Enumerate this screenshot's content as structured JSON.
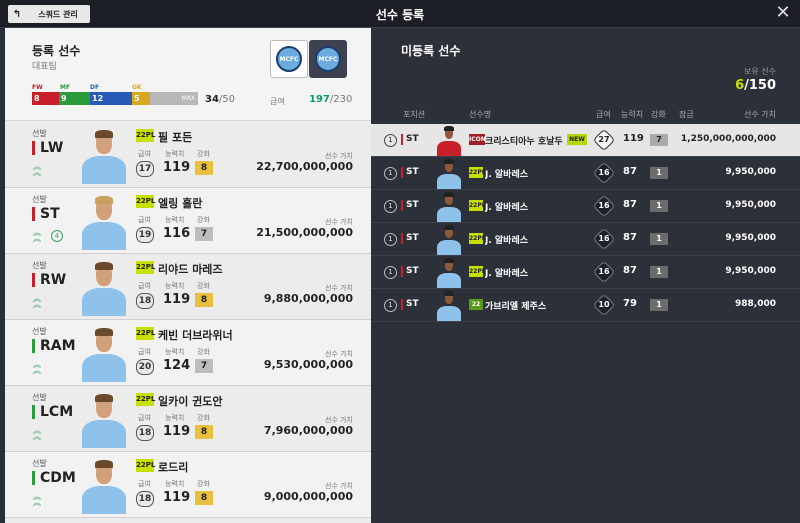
{
  "topbar": {
    "squad_button": "스쿼드 관리",
    "title": "선수 등록",
    "close": "✕"
  },
  "left": {
    "title": "등록 선수",
    "subtitle": "대표팀",
    "pos_counts": [
      {
        "label": "FW",
        "count": "8",
        "color": "#c8202a"
      },
      {
        "label": "MF",
        "count": "9",
        "color": "#2a9a3a"
      },
      {
        "label": "DF",
        "count": "12",
        "color": "#2a5ab8"
      },
      {
        "label": "GK",
        "count": "5",
        "color": "#d8a820"
      }
    ],
    "max_label": "MAX",
    "count": "34",
    "count_max": "/50",
    "salary_label": "급여",
    "salary": "197",
    "salary_max": "/230",
    "players": [
      {
        "label": "선발",
        "pos": "LW",
        "season": "22PL",
        "name": "필 포든",
        "pay": "17",
        "ovr": "119",
        "upg": "8",
        "upg_color": "gold",
        "value": "22,700,000,000",
        "pos_color": "red",
        "extra": ""
      },
      {
        "label": "선발",
        "pos": "ST",
        "season": "22PL",
        "name": "엘링 홀란",
        "pay": "19",
        "ovr": "116",
        "upg": "7",
        "upg_color": "gray",
        "value": "21,500,000,000",
        "pos_color": "red",
        "extra": "4"
      },
      {
        "label": "선발",
        "pos": "RW",
        "season": "22PL",
        "name": "리야드 마레즈",
        "pay": "18",
        "ovr": "119",
        "upg": "8",
        "upg_color": "gold",
        "value": "9,880,000,000",
        "pos_color": "red",
        "extra": ""
      },
      {
        "label": "선발",
        "pos": "RAM",
        "season": "22PL",
        "name": "케빈 더브라위너",
        "pay": "20",
        "ovr": "124",
        "upg": "7",
        "upg_color": "gray",
        "value": "9,530,000,000",
        "pos_color": "mid",
        "extra": ""
      },
      {
        "label": "선발",
        "pos": "LCM",
        "season": "22PL",
        "name": "일카이 귄도안",
        "pay": "18",
        "ovr": "119",
        "upg": "8",
        "upg_color": "gold",
        "value": "7,960,000,000",
        "pos_color": "mid",
        "extra": ""
      },
      {
        "label": "선발",
        "pos": "CDM",
        "season": "22PL",
        "name": "로드리",
        "pay": "18",
        "ovr": "119",
        "upg": "8",
        "upg_color": "gold",
        "value": "9,000,000,000",
        "pos_color": "mid",
        "extra": ""
      }
    ],
    "mini_labels": {
      "pay": "급여",
      "ovr": "능력치",
      "upg": "강화",
      "value": "선수 가치"
    }
  },
  "right": {
    "title": "미등록 선수",
    "own_label": "보유 선수",
    "own_count": "6",
    "own_max": "/150",
    "headers": {
      "pos": "포지션",
      "name": "선수명",
      "pay": "급여",
      "ovr": "능력치",
      "upg": "강화",
      "lock": "잠금",
      "value": "선수 가치"
    },
    "players": [
      {
        "rank": "1",
        "pos": "ST",
        "season": "ICON",
        "season_style": "red",
        "name": "크리스티아누 호날두",
        "new": "NEW",
        "pay": "27",
        "ovr": "119",
        "upg": "7",
        "value": "1,250,000,000,000",
        "selected": true,
        "photo": "red"
      },
      {
        "rank": "1",
        "pos": "ST",
        "season": "22PL",
        "season_style": "",
        "name": "J. 알바레스",
        "new": "",
        "pay": "16",
        "ovr": "87",
        "upg": "1",
        "value": "9,950,000",
        "selected": false,
        "photo": "dark"
      },
      {
        "rank": "1",
        "pos": "ST",
        "season": "22PL",
        "season_style": "",
        "name": "J. 알바레스",
        "new": "",
        "pay": "16",
        "ovr": "87",
        "upg": "1",
        "value": "9,950,000",
        "selected": false,
        "photo": "dark"
      },
      {
        "rank": "1",
        "pos": "ST",
        "season": "22PL",
        "season_style": "",
        "name": "J. 알바레스",
        "new": "",
        "pay": "16",
        "ovr": "87",
        "upg": "1",
        "value": "9,950,000",
        "selected": false,
        "photo": "dark"
      },
      {
        "rank": "1",
        "pos": "ST",
        "season": "22PL",
        "season_style": "",
        "name": "J. 알바레스",
        "new": "",
        "pay": "16",
        "ovr": "87",
        "upg": "1",
        "value": "9,950,000",
        "selected": false,
        "photo": "dark"
      },
      {
        "rank": "1",
        "pos": "ST",
        "season": "22",
        "season_style": "green",
        "name": "가브리엘 제주스",
        "new": "",
        "pay": "10",
        "ovr": "79",
        "upg": "1",
        "value": "988,000",
        "selected": false,
        "photo": "darkwhite"
      }
    ]
  }
}
